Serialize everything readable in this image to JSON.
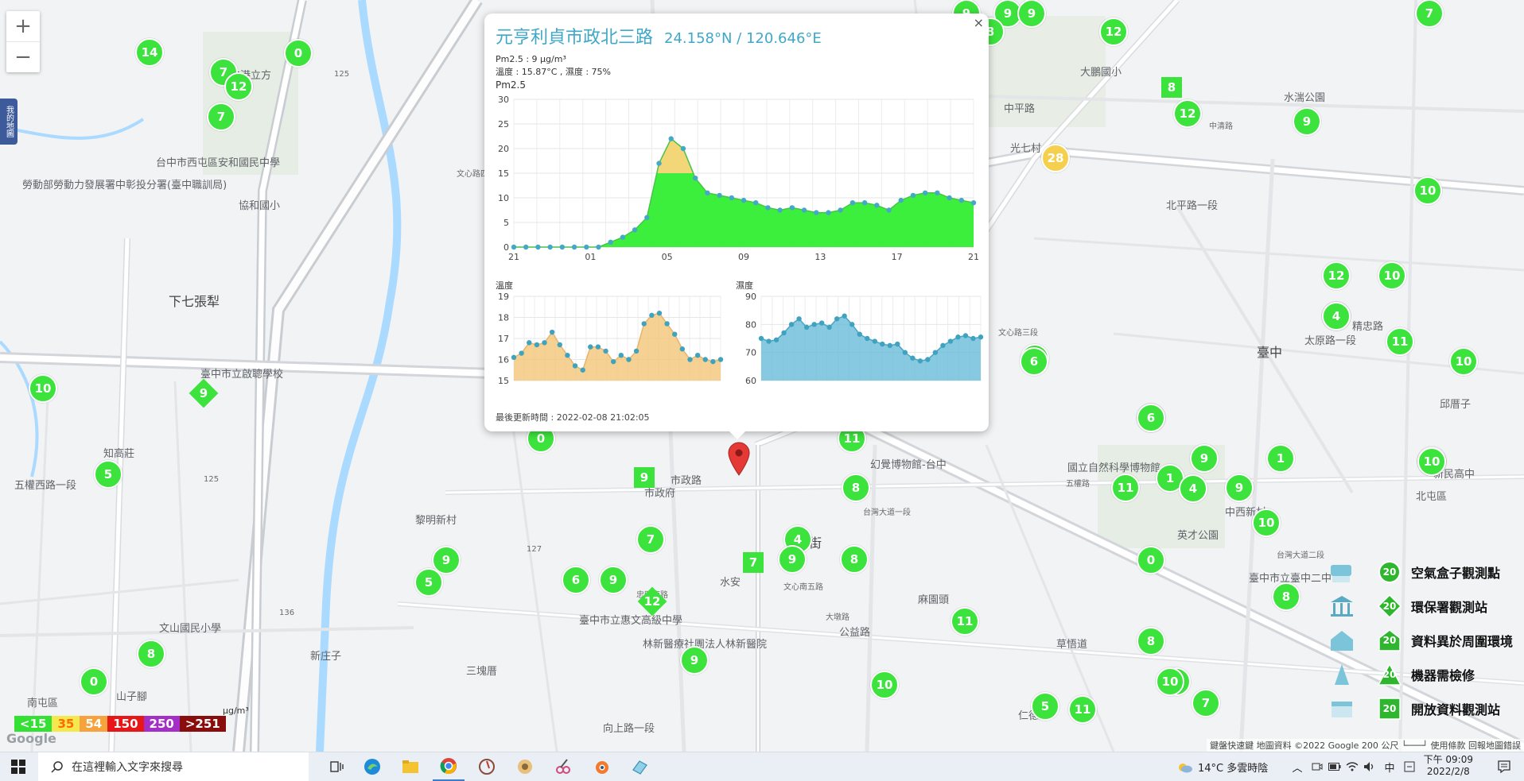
{
  "map": {
    "zoom_in": "+",
    "zoom_out": "−",
    "side_tab": "我的地圖",
    "place_labels": [
      "台中市西屯區安和國民中學",
      "勞動部勞動力發展署中彰投分署(臺中職訓局)",
      "協和國小",
      "下七張犁",
      "臺中市立啟聰學校",
      "知高莊",
      "五權西路一段",
      "黎明新村",
      "文山國民小學",
      "山子腳",
      "南屯區",
      "新庄子",
      "三塊厝",
      "林新醫療社團法人林新醫院",
      "臺中市立惠文高級中學",
      "麻園頭",
      "草悟道",
      "英才公園",
      "臺中市立臺中二中",
      "國立自然科學博物館",
      "幻覺博物館-台中",
      "中西新村",
      "北屯區",
      "新民高中",
      "邱厝子",
      "太原路一段",
      "臺中",
      "光七村",
      "北平路一段",
      "水湍公園",
      "大鵬國小",
      "中平路",
      "台中港立方",
      "市政路",
      "市政府",
      "水安",
      "大進街",
      "公益路",
      "向上路一段",
      "仁德里",
      "精忠路"
    ],
    "road_labels": [
      "125",
      "125",
      "127",
      "136",
      "台灣大道二段",
      "台灣大道一段",
      "文心路四段",
      "文心路三段",
      "文心南五路",
      "大墩路",
      "中清路",
      "五權路",
      "忠明南路"
    ],
    "markers": [
      {
        "label": "14",
        "shape": "circle",
        "color": "#3de33d"
      },
      {
        "label": "0",
        "shape": "circle",
        "color": "#3de33d"
      },
      {
        "label": "7",
        "shape": "circle",
        "color": "#3de33d"
      },
      {
        "label": "12",
        "shape": "circle",
        "color": "#3de33d"
      },
      {
        "label": "7",
        "shape": "circle",
        "color": "#3de33d"
      },
      {
        "label": "10",
        "shape": "circle",
        "color": "#3de33d"
      },
      {
        "label": "9",
        "shape": "diamond",
        "color": "#3de33d"
      },
      {
        "label": "5",
        "shape": "circle",
        "color": "#3de33d"
      },
      {
        "label": "8",
        "shape": "circle",
        "color": "#3de33d"
      },
      {
        "label": "0",
        "shape": "circle",
        "color": "#3de33d"
      },
      {
        "label": "0",
        "shape": "circle",
        "color": "#3de33d"
      },
      {
        "label": "9",
        "shape": "square",
        "color": "#3de33d"
      },
      {
        "label": "9",
        "shape": "circle",
        "color": "#3de33d"
      },
      {
        "label": "5",
        "shape": "circle",
        "color": "#3de33d"
      },
      {
        "label": "11",
        "shape": "circle",
        "color": "#3de33d"
      },
      {
        "label": "8",
        "shape": "circle",
        "color": "#3de33d"
      },
      {
        "label": "7",
        "shape": "circle",
        "color": "#3de33d"
      },
      {
        "label": "4",
        "shape": "circle",
        "color": "#3de33d"
      },
      {
        "label": "7",
        "shape": "square",
        "color": "#3de33d"
      },
      {
        "label": "9",
        "shape": "circle",
        "color": "#3de33d"
      },
      {
        "label": "8",
        "shape": "circle",
        "color": "#3de33d"
      },
      {
        "label": "9",
        "shape": "circle",
        "color": "#3de33d"
      },
      {
        "label": "6",
        "shape": "circle",
        "color": "#3de33d"
      },
      {
        "label": "8",
        "shape": "circle",
        "color": "#3de33d"
      },
      {
        "label": "9",
        "shape": "circle",
        "color": "#3de33d"
      },
      {
        "label": "12",
        "shape": "diamond",
        "color": "#3de33d"
      },
      {
        "label": "10",
        "shape": "circle",
        "color": "#3de33d"
      },
      {
        "label": "9",
        "shape": "circle",
        "color": "#3de33d"
      },
      {
        "label": "10",
        "shape": "circle",
        "color": "#3de33d"
      },
      {
        "label": "11",
        "shape": "circle",
        "color": "#3de33d"
      },
      {
        "label": "5",
        "shape": "circle",
        "color": "#3de33d"
      },
      {
        "label": "11",
        "shape": "circle",
        "color": "#3de33d"
      },
      {
        "label": "4",
        "shape": "circle",
        "color": "#3de33d"
      },
      {
        "label": "13",
        "shape": "circle",
        "color": "#3de33d"
      },
      {
        "label": "6",
        "shape": "circle",
        "color": "#3de33d"
      },
      {
        "label": "0",
        "shape": "circle",
        "color": "#3de33d"
      },
      {
        "label": "8",
        "shape": "circle",
        "color": "#3de33d"
      },
      {
        "label": "10",
        "shape": "circle",
        "color": "#3de33d"
      },
      {
        "label": "7",
        "shape": "circle",
        "color": "#3de33d"
      },
      {
        "label": "11",
        "shape": "circle",
        "color": "#3de33d"
      },
      {
        "label": "1",
        "shape": "circle",
        "color": "#3de33d"
      },
      {
        "label": "4",
        "shape": "circle",
        "color": "#3de33d"
      },
      {
        "label": "1",
        "shape": "circle",
        "color": "#3de33d"
      },
      {
        "label": "9",
        "shape": "circle",
        "color": "#3de33d"
      },
      {
        "label": "10",
        "shape": "circle",
        "color": "#3de33d"
      },
      {
        "label": "1",
        "shape": "circle",
        "color": "#3de33d"
      },
      {
        "label": "13",
        "shape": "circle",
        "color": "#3de33d"
      },
      {
        "label": "8",
        "shape": "circle",
        "color": "#3de33d"
      },
      {
        "label": "12",
        "shape": "circle",
        "color": "#3de33d"
      },
      {
        "label": "10",
        "shape": "circle",
        "color": "#3de33d"
      },
      {
        "label": "8",
        "shape": "circle",
        "color": "#3de33d"
      },
      {
        "label": "11",
        "shape": "circle",
        "color": "#3de33d"
      },
      {
        "label": "10",
        "shape": "circle",
        "color": "#3de33d"
      },
      {
        "label": "9",
        "shape": "circle",
        "color": "#3de33d"
      },
      {
        "label": "12",
        "shape": "circle",
        "color": "#3de33d"
      },
      {
        "label": "8",
        "shape": "square",
        "color": "#3de33d"
      },
      {
        "label": "12",
        "shape": "circle",
        "color": "#3de33d"
      },
      {
        "label": "28",
        "shape": "circle",
        "color": "#f5d04f"
      },
      {
        "label": "7",
        "shape": "circle",
        "color": "#3de33d"
      },
      {
        "label": "9",
        "shape": "circle",
        "color": "#3de33d"
      },
      {
        "label": "9",
        "shape": "circle",
        "color": "#3de33d"
      },
      {
        "label": "9",
        "shape": "circle",
        "color": "#3de33d"
      },
      {
        "label": "8",
        "shape": "circle",
        "color": "#3de33d"
      },
      {
        "label": "4",
        "shape": "circle",
        "color": "#3de33d"
      },
      {
        "label": "10",
        "shape": "circle",
        "color": "#3de33d"
      },
      {
        "label": "6",
        "shape": "circle",
        "color": "#3de33d"
      }
    ]
  },
  "popup": {
    "title": "元亨利貞市政北三路",
    "coords": "24.158°N / 120.646°E",
    "pm25_line": "Pm2.5 : 9 μg/m³",
    "env_line": "溫度 : 15.87°C , 濕度 : 75%",
    "updated": "最後更新時間 : 2022-02-08 21:02:05",
    "close": "×"
  },
  "chart_data": [
    {
      "type": "area",
      "title": "Pm2.5",
      "x_ticks": [
        "21",
        "01",
        "05",
        "09",
        "13",
        "17",
        "21"
      ],
      "ylim": [
        0,
        30
      ],
      "y_ticks": [
        0,
        5,
        10,
        15,
        20,
        25,
        30
      ],
      "values": [
        0,
        0,
        0,
        0,
        0,
        0,
        0,
        0,
        1,
        2,
        3.5,
        6,
        17,
        22,
        20,
        14,
        11,
        10.5,
        10,
        9.5,
        9,
        8,
        7.5,
        8,
        7.5,
        7,
        7,
        7.5,
        9,
        9,
        8.5,
        7.5,
        9.5,
        10.5,
        11,
        11,
        10,
        9.5,
        9
      ],
      "grid": true,
      "colors": {
        "low": "#33ee33",
        "mid": "#f2d471"
      }
    },
    {
      "type": "area",
      "title": "溫度",
      "ylim": [
        15,
        19
      ],
      "y_ticks": [
        15,
        16,
        17,
        18,
        19
      ],
      "values": [
        16.1,
        16.3,
        16.8,
        16.7,
        16.8,
        17.3,
        16.7,
        16.2,
        15.7,
        15.5,
        16.6,
        16.6,
        16.4,
        15.9,
        16.2,
        16.0,
        16.4,
        17.7,
        18.1,
        18.2,
        17.7,
        17.2,
        16.5,
        16.0,
        16.2,
        16.0,
        15.9,
        16.0
      ],
      "grid": true,
      "color": "#f2c578"
    },
    {
      "type": "area",
      "title": "濕度",
      "ylim": [
        60,
        90
      ],
      "y_ticks": [
        60,
        70,
        80,
        90
      ],
      "values": [
        75,
        74,
        74.5,
        77,
        80,
        82,
        79,
        80,
        80.5,
        79,
        82,
        83,
        80,
        76.5,
        75,
        74,
        73,
        72.5,
        73,
        70,
        68,
        67,
        67.5,
        70,
        72.5,
        74,
        75.5,
        76,
        75,
        75.5
      ],
      "grid": true,
      "color": "#69bcd8"
    }
  ],
  "legend": {
    "unit": "μg/m³",
    "scale": [
      {
        "label": "<15",
        "bg": "#33e033",
        "fg": "#ffffff"
      },
      {
        "label": "35",
        "bg": "#f5e84f",
        "fg": "#ff6a00"
      },
      {
        "label": "54",
        "bg": "#f7a33d",
        "fg": "#ffffff"
      },
      {
        "label": "150",
        "bg": "#e81717",
        "fg": "#ffffff"
      },
      {
        "label": "250",
        "bg": "#a32fc6",
        "fg": "#ffffff"
      },
      {
        "label": ">251",
        "bg": "#8a0d0d",
        "fg": "#ffffff"
      }
    ],
    "types": [
      {
        "label": "空氣盒子觀測點",
        "marker": "20",
        "shape": "circle"
      },
      {
        "label": "環保署觀測站",
        "marker": "20",
        "shape": "diamond"
      },
      {
        "label": "資料異於周圍環境",
        "marker": "20",
        "shape": "house"
      },
      {
        "label": "機器需檢修",
        "marker": "20",
        "shape": "triangle"
      },
      {
        "label": "開放資料觀測站",
        "marker": "20",
        "shape": "square"
      }
    ]
  },
  "attribution": {
    "google": "Google",
    "text": "鍵盤快速鍵   地圖資料 ©2022 Google   200 公尺 └───┘   使用條款   回報地圖錯誤"
  },
  "taskbar": {
    "search_placeholder": "在這裡輸入文字來搜尋",
    "weather": "14°C  多雲時陰",
    "ime": "中",
    "time": "下午 09:09",
    "date": "2022/2/8"
  }
}
